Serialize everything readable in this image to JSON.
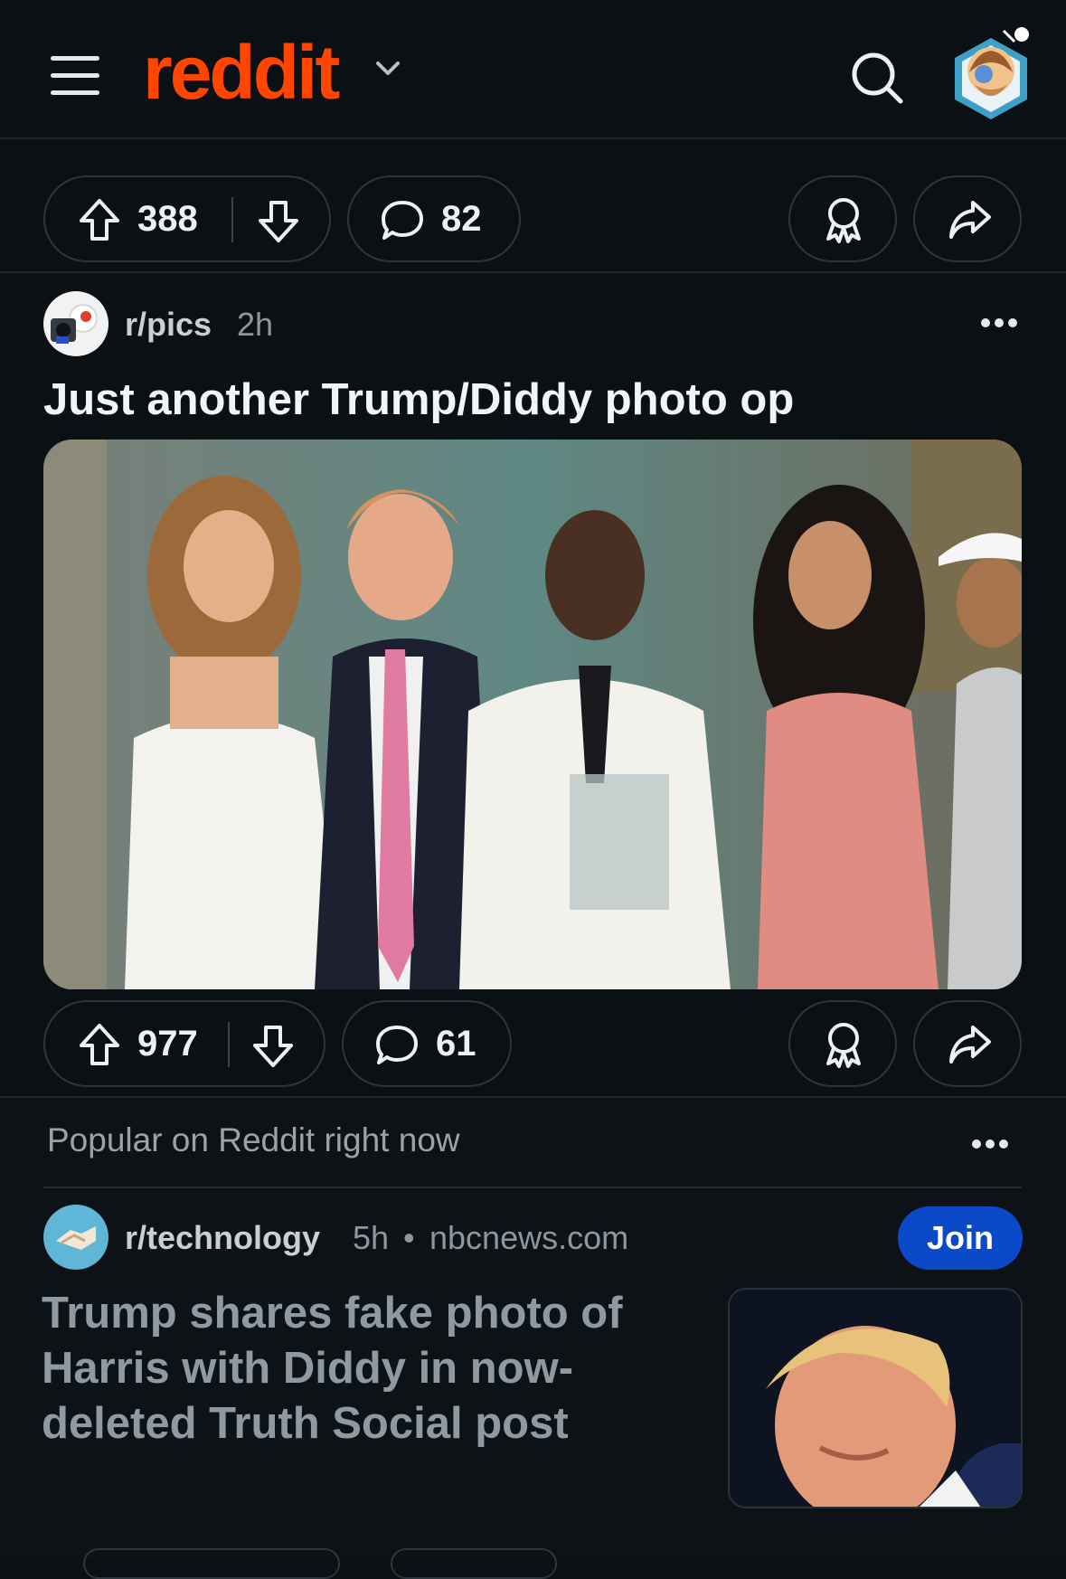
{
  "header": {
    "logo_text": "reddit"
  },
  "prev_post_actions": {
    "upvotes": "388",
    "comments": "82"
  },
  "post": {
    "subreddit": "r/pics",
    "age": "2h",
    "title": "Just another Trump/Diddy photo op",
    "upvotes": "977",
    "comments": "61"
  },
  "popular": {
    "label": "Popular on Reddit right now",
    "subreddit": "r/technology",
    "age": "5h",
    "separator": "•",
    "domain": "nbcnews.com",
    "join_label": "Join",
    "title": "Trump shares fake photo of Harris with Diddy in now-deleted Truth Social post"
  },
  "colors": {
    "brand": "#ff4500",
    "background": "#0b1014",
    "join": "#0a49c8"
  },
  "icons": [
    "menu-icon",
    "chevron-down-icon",
    "search-icon",
    "upvote-icon",
    "downvote-icon",
    "comment-icon",
    "award-icon",
    "share-icon",
    "more-icon"
  ]
}
